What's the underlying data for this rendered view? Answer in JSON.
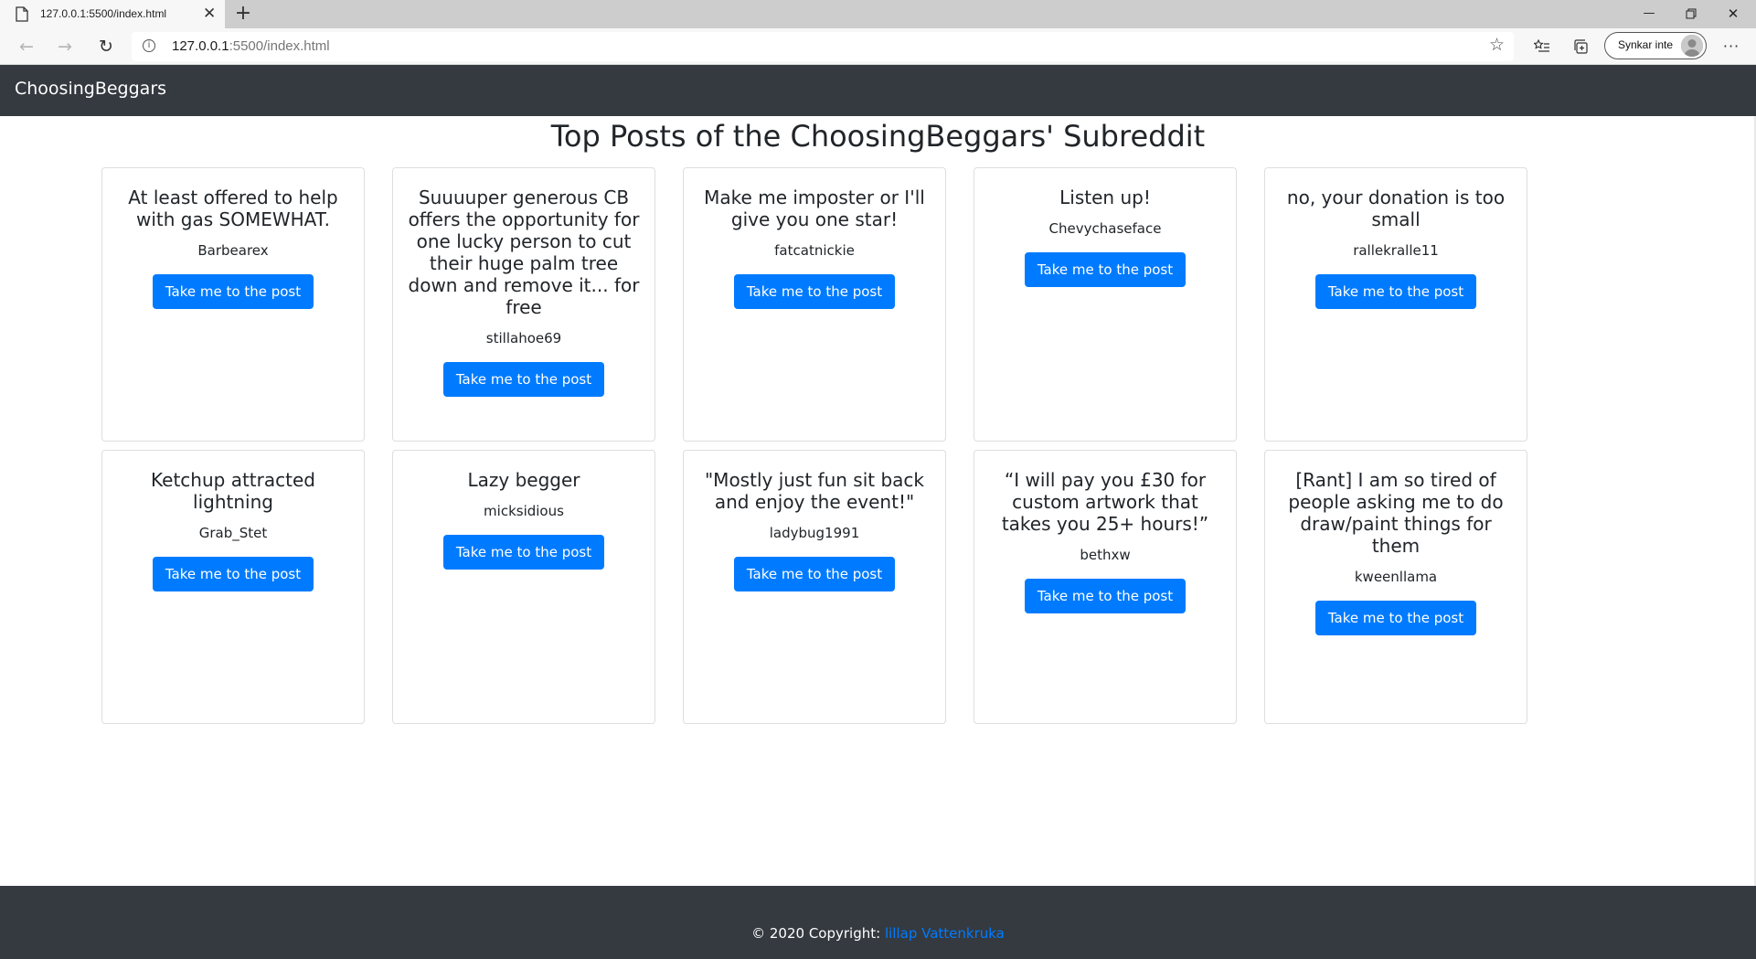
{
  "browser": {
    "tab_title": "127.0.0.1:5500/index.html",
    "new_tab_icon": "plus-icon",
    "url_host": "127.0.0.1",
    "url_rest": ":5500/index.html",
    "sync_label": "Synkar inte",
    "more_label": "···"
  },
  "navbar": {
    "brand": "ChoosingBeggars"
  },
  "page": {
    "title": "Top Posts of the ChoosingBeggars' Subreddit"
  },
  "button_label": "Take me to the post",
  "posts": [
    {
      "title": "At least offered to help with gas SOMEWHAT.",
      "author": "Barbearex"
    },
    {
      "title": "Suuuuper generous CB offers the opportunity for one lucky person to cut their huge palm tree down and remove it... for free",
      "author": "stillahoe69"
    },
    {
      "title": "Make me imposter or I'll give you one star!",
      "author": "fatcatnickie"
    },
    {
      "title": "Listen up!",
      "author": "Chevychaseface"
    },
    {
      "title": "no, your donation is too small",
      "author": "rallekralle11"
    },
    {
      "title": "Ketchup attracted lightning",
      "author": "Grab_Stet"
    },
    {
      "title": "Lazy begger",
      "author": "micksidious"
    },
    {
      "title": "\"Mostly just fun sit back and enjoy the event!\"",
      "author": "ladybug1991"
    },
    {
      "title": "“I will pay you £30 for custom artwork that takes you 25+ hours!”",
      "author": "bethxw"
    },
    {
      "title": "[Rant] I am so tired of people asking me to do draw/paint things for them",
      "author": "kweenllama"
    }
  ],
  "footer": {
    "prefix": "© 2020 Copyright: ",
    "link": "lillap Vattenkruka"
  },
  "colors": {
    "navbar_bg": "#343a40",
    "button_bg": "#007bff",
    "link": "#007bff"
  }
}
